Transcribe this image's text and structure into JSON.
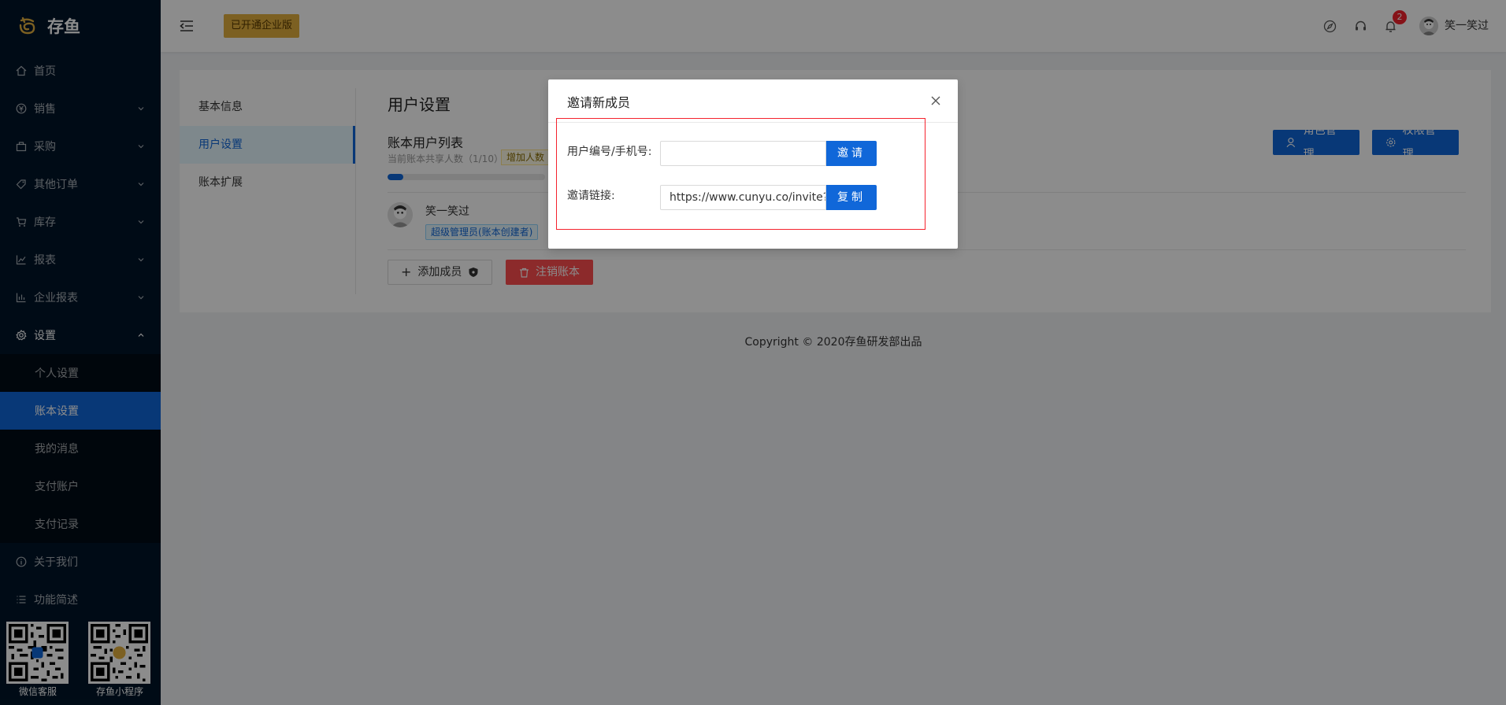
{
  "app": {
    "name": "存鱼"
  },
  "sidebar": {
    "items": [
      {
        "label": "首页",
        "icon": "home-icon"
      },
      {
        "label": "销售",
        "icon": "sales-icon"
      },
      {
        "label": "采购",
        "icon": "purchase-icon"
      },
      {
        "label": "其他订单",
        "icon": "tag-icon"
      },
      {
        "label": "库存",
        "icon": "cart-icon"
      },
      {
        "label": "报表",
        "icon": "line-chart-icon"
      },
      {
        "label": "企业报表",
        "icon": "bar-chart-icon"
      },
      {
        "label": "设置",
        "icon": "gear-icon"
      }
    ],
    "settings_sub": [
      {
        "label": "个人设置"
      },
      {
        "label": "账本设置"
      },
      {
        "label": "我的消息"
      },
      {
        "label": "支付账户"
      },
      {
        "label": "支付记录"
      }
    ],
    "bottom_items": [
      {
        "label": "关于我们",
        "icon": "info-icon"
      },
      {
        "label": "功能简述",
        "icon": "list-icon"
      }
    ],
    "qr": [
      {
        "caption": "微信客服"
      },
      {
        "caption": "存鱼小程序"
      }
    ]
  },
  "header": {
    "enterprise_badge": "已开通企业版",
    "notification_count": "2",
    "username": "笑一笑过"
  },
  "settings": {
    "tabs": [
      {
        "label": "基本信息"
      },
      {
        "label": "用户设置"
      },
      {
        "label": "账本扩展"
      }
    ],
    "title": "用户设置",
    "list_title": "账本用户列表",
    "share_text": "当前账本共享人数（1/10）",
    "add_seat": "增加人数",
    "usage_fraction": 0.1,
    "role_button": "角色管理",
    "perm_button": "权限管理",
    "member": {
      "name": "笑一笑过",
      "tag": "超级管理员(账本创建者)"
    },
    "add_member_button": "添加成员",
    "cancel_book_button": "注销账本"
  },
  "footer": {
    "text": "Copyright",
    "suffix": "2020存鱼研发部出品"
  },
  "modal": {
    "title": "邀请新成员",
    "user_label": "用户编号/手机号:",
    "user_value": "",
    "invite_button": "邀请",
    "link_label": "邀请链接:",
    "link_value": "https://www.cunyu.co/invite?cc",
    "copy_button": "复制"
  },
  "colors": {
    "primary": "#1067d9",
    "sidebar_bg": "#001529",
    "danger": "#ff4d4f",
    "badge_gold": "#e2b03e",
    "highlight_red": "#f5222d"
  }
}
